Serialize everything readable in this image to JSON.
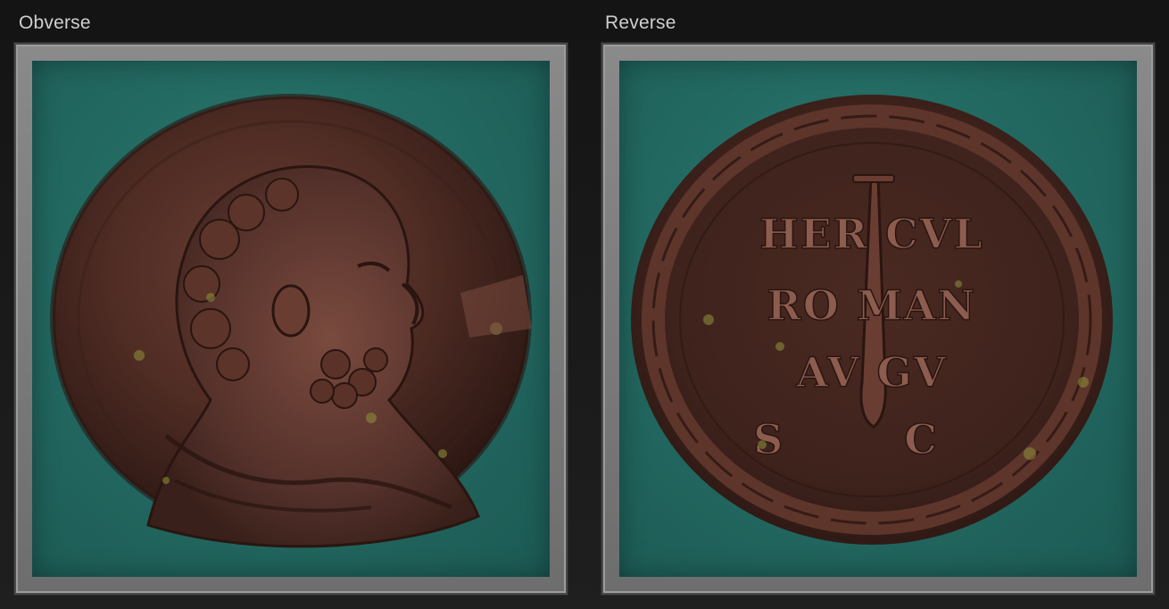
{
  "panels": {
    "obverse": {
      "title": "Obverse"
    },
    "reverse": {
      "title": "Reverse"
    }
  },
  "reverse_inscription": {
    "line1": "HER CVL",
    "line2": "RO MAN",
    "line3": "AV GV",
    "line4": "S C"
  },
  "colors": {
    "background": "#1b1b1b",
    "frame": "#7a7a7a",
    "felt": "#236a62",
    "bronze": "#4a2a22",
    "patina": "#8a8a3a"
  }
}
